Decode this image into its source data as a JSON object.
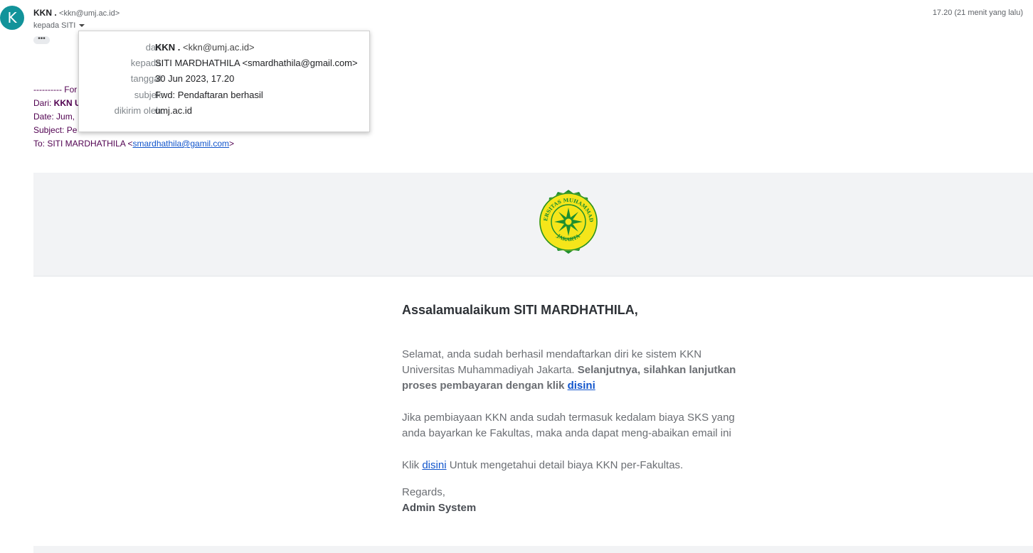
{
  "header": {
    "avatar_letter": "K",
    "sender_name": "KKN .",
    "sender_email": "<kkn@umj.ac.id>",
    "recipient": "kepada SITI",
    "time": "17.20 (21 menit yang lalu)",
    "more_dots": "•••"
  },
  "popup": {
    "from_label": "dari:",
    "from_name": "KKN .",
    "from_email": "<kkn@umj.ac.id>",
    "to_label": "kepada:",
    "to_value": "SITI MARDHATHILA <smardhathila@gmail.com>",
    "date_label": "tanggal:",
    "date_value": "30 Jun 2023, 17.20",
    "subject_label": "subjek:",
    "subject_value": "Fwd: Pendaftaran berhasil",
    "mailedby_label": "dikirim oleh:",
    "mailedby_value": "umj.ac.id"
  },
  "forwarded": {
    "line1": "---------- For",
    "from_prefix": "Dari: ",
    "from_bold": "KKN U",
    "date": "Date: Jum,",
    "subject": "Subject: Pe",
    "to_prefix": "To: SITI MARDHATHILA <",
    "to_email": "smardhathila@gamil.com",
    "to_suffix": ">"
  },
  "body": {
    "greeting": "Assalamualaikum SITI MARDHATHILA,",
    "p1_text": "Selamat, anda sudah berhasil mendaftarkan diri ke sistem KKN Universitas Muhammadiyah Jakarta. ",
    "p1_bold": "Selanjutnya, silahkan lanjutkan proses pembayaran dengan klik ",
    "p1_link": "disini",
    "p2_text": "Jika pembiayaan KKN anda sudah termasuk kedalam biaya SKS yang anda bayarkan ke Fakultas, maka anda dapat meng-abaikan email ini",
    "p3_prefix": "Klik ",
    "p3_link": "disini",
    "p3_suffix": " Untuk mengetahui detail biaya KKN per-Fakultas.",
    "regards": "Regards,",
    "signature": "Admin System"
  },
  "logo": {
    "arc_top": "UNIVERSITAS MUHAMMADIYAH",
    "arc_bottom": "JAKARTA",
    "colors": {
      "outer": "#1f8f2e",
      "fill": "#f5e51a",
      "inner": "#1f8f2e"
    }
  }
}
